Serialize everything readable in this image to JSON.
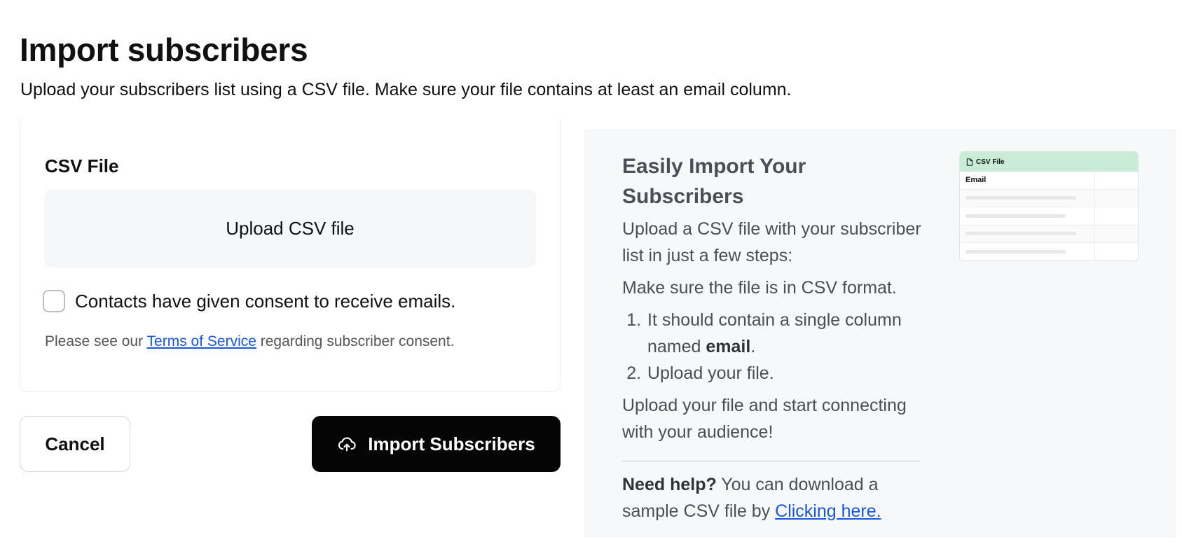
{
  "page": {
    "title": "Import subscribers",
    "subtitle": "Upload your subscribers list using a CSV file. Make sure your file contains at least an email column."
  },
  "form": {
    "field_label": "CSV File",
    "upload_label": "Upload CSV file",
    "consent_label": "Contacts have given consent to receive emails.",
    "consent_checked": false,
    "tos_prefix": "Please see our ",
    "tos_link": "Terms of Service",
    "tos_suffix": " regarding subscriber consent."
  },
  "actions": {
    "cancel_label": "Cancel",
    "import_label": "Import Subscribers",
    "import_icon": "cloud-upload-icon"
  },
  "help": {
    "title": "Easily Import Your Subscribers",
    "intro": "Upload a CSV file with your subscriber list in just a few steps:",
    "format_note": "Make sure the file is in CSV format.",
    "step1_prefix": "It should contain a single column named ",
    "step1_bold": "email",
    "step1_suffix": ".",
    "step2": "Upload your file.",
    "outro": "Upload your file and start connecting with your audience!",
    "need_help_bold": "Need help?",
    "need_help_text": " You can download a sample CSV file by ",
    "need_help_link": "Clicking here."
  },
  "preview": {
    "header": "CSV File",
    "header_icon": "file-icon",
    "column_label": "Email",
    "header_color": "#c8ecd6"
  },
  "colors": {
    "primary_button": "#050505",
    "link": "#1a56db",
    "panel_bg": "#f7f8fa"
  }
}
